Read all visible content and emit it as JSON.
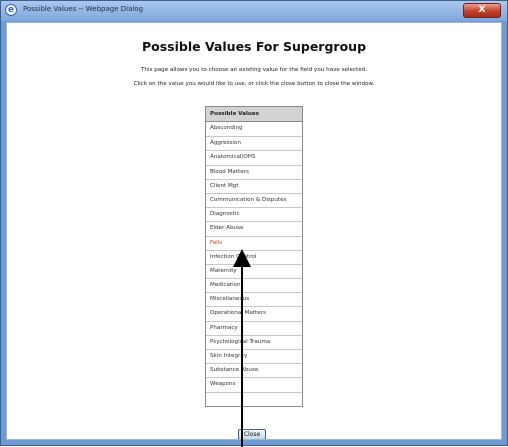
{
  "window": {
    "title": "Possible Values  -- Webpage Dialog",
    "close_label": "X"
  },
  "page": {
    "heading": "Possible Values For Supergroup",
    "intro_line1": "This page allows you to choose an existing value for the field you have selected.",
    "intro_line2": "Click on the value you would like to use, or click the close button to close the window."
  },
  "values_table": {
    "header": "Possible Values",
    "items": [
      "Absconding",
      "Aggression",
      "Anatomical/OHS",
      "Blood Matters",
      "Client Mgt",
      "Communication & Disputes",
      "Diagnostic",
      "Elder Abuse",
      "Falls",
      "Infection Control",
      "Maternity",
      "Medication",
      "Miscellaneous",
      "Operational Matters",
      "Pharmacy",
      "Psychological Trauma",
      "Skin Integrity",
      "Substance Abuse",
      "Weapons"
    ],
    "highlighted_item": "Falls",
    "highlight_color": "#d43a2a"
  },
  "footer": {
    "close_button_label": "Close"
  }
}
